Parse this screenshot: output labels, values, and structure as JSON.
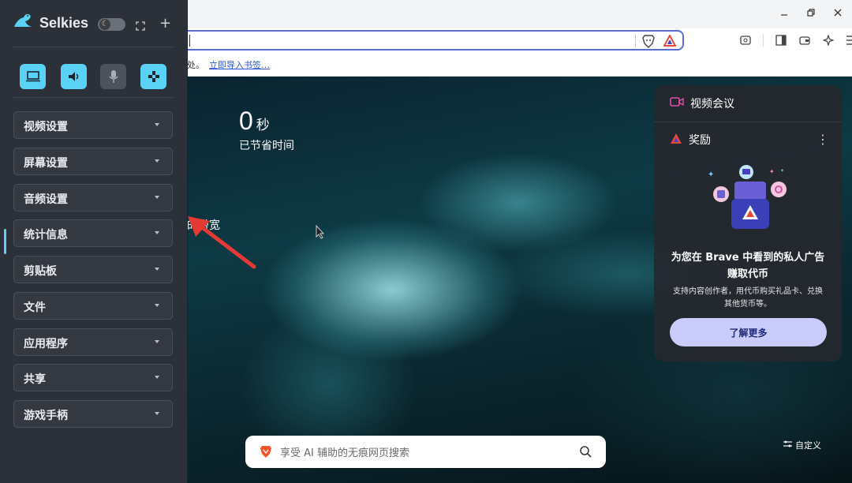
{
  "browser": {
    "bookmarks_text": "处。",
    "bookmarks_link": "立即导入书签…",
    "window_controls": [
      "minimize-icon",
      "restore-icon",
      "close-icon"
    ]
  },
  "newtab": {
    "stat_value": "0",
    "stat_unit": "秒",
    "stat_label": "已节省时间",
    "bandwidth_label": "的带宽",
    "search_placeholder": "享受 AI 辅助的无痕网页搜索",
    "customize_label": "自定义"
  },
  "rewards_card": {
    "video_label": "视频会议",
    "rewards_label": "奖励",
    "title_line1": "为您在 Brave 中看到的私人广告",
    "title_line2": "赚取代币",
    "desc_line1": "支持内容创作者，用代币购买礼品卡、兑换",
    "desc_line2": "其他货币等。",
    "button_label": "了解更多"
  },
  "sidebar": {
    "app_name": "Selkies",
    "sections": [
      {
        "label": "视频设置"
      },
      {
        "label": "屏幕设置"
      },
      {
        "label": "音频设置"
      },
      {
        "label": "统计信息"
      },
      {
        "label": "剪贴板"
      },
      {
        "label": "文件"
      },
      {
        "label": "应用程序"
      },
      {
        "label": "共享"
      },
      {
        "label": "游戏手柄"
      }
    ]
  },
  "colors": {
    "accent": "#5ad2f5",
    "sidebar_bg": "#2c3038",
    "brave_orange": "#fb542b",
    "rewards_button": "#c9ccfb",
    "annotation_arrow": "#e53935"
  }
}
